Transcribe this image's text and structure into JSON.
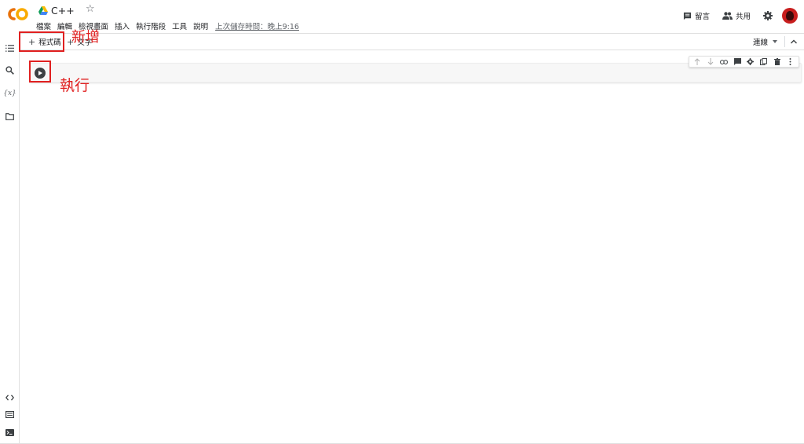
{
  "header": {
    "title": "C++",
    "menu": [
      "檔案",
      "編輯",
      "檢視畫面",
      "插入",
      "執行階段",
      "工具",
      "說明"
    ],
    "last_saved": "上次儲存時間：晚上9:16",
    "comment_label": "留言",
    "share_label": "共用"
  },
  "toolbar": {
    "add_code": "程式碼",
    "add_text": "文字",
    "connect": "連線"
  },
  "annotations": {
    "add": "新增",
    "run": "執行"
  },
  "icons": {
    "sidebar_top": [
      "table-of-contents-icon",
      "search-icon",
      "variables-icon",
      "folder-icon"
    ],
    "sidebar_bottom": [
      "code-snippets-icon",
      "command-palette-icon",
      "terminal-icon"
    ],
    "cell_toolbar": [
      "move-up-icon",
      "move-down-icon",
      "link-icon",
      "comment-icon",
      "settings-icon",
      "mirror-cell-icon",
      "delete-icon",
      "more-icon"
    ]
  },
  "colors": {
    "logo_orange": "#f9ab00",
    "logo_dark_orange": "#e8710a",
    "annotation_red": "#e02020",
    "avatar_red": "#c81d1d"
  }
}
